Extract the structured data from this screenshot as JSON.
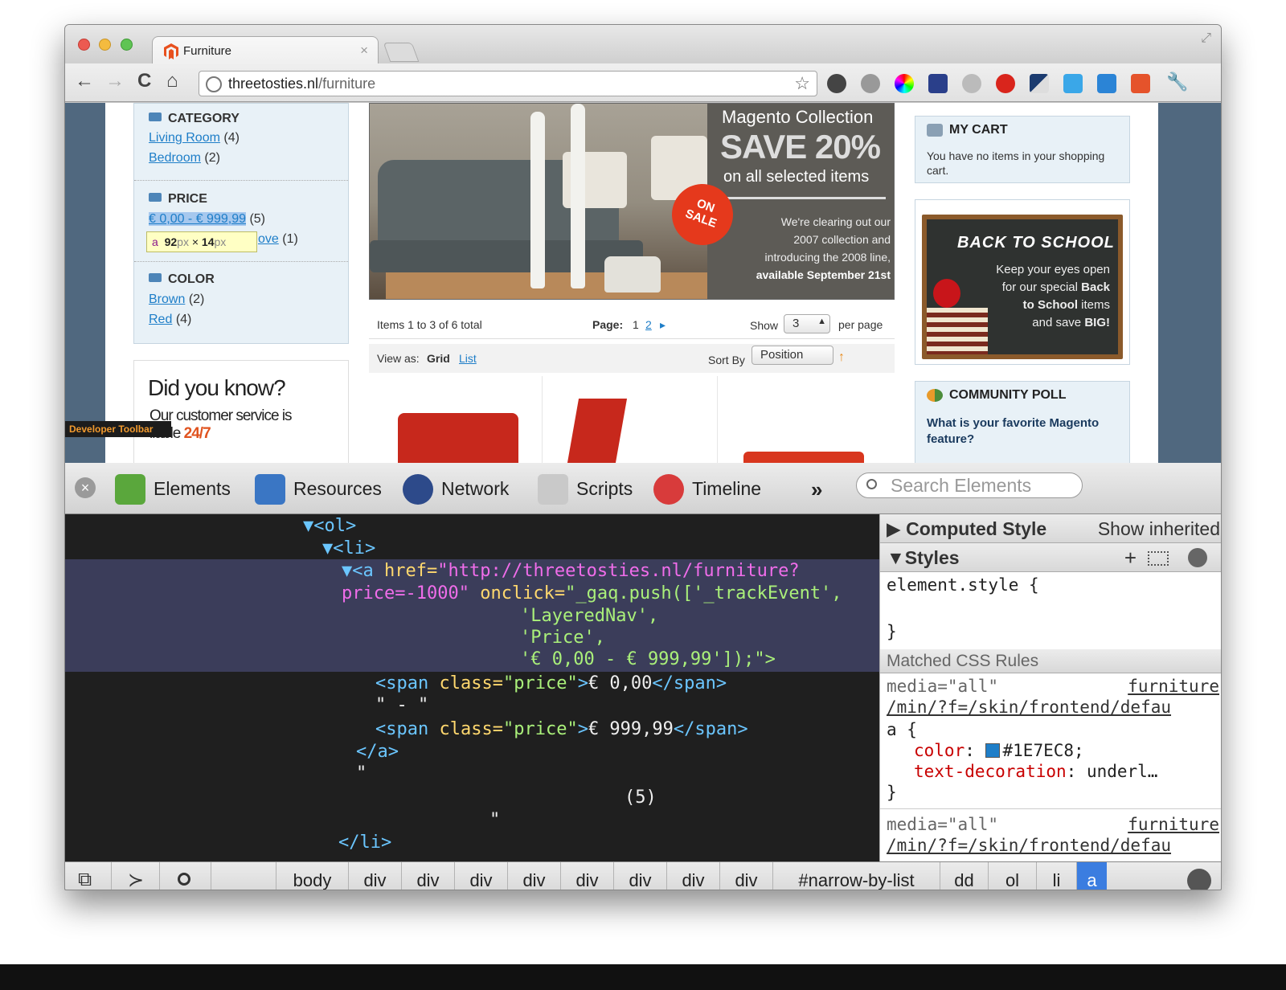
{
  "browser": {
    "tab_title": "Furniture",
    "tab_close": "×",
    "url_host": "threetosties.nl",
    "url_path": "/furniture",
    "resize_glyph": "⤢",
    "nav": {
      "back": "←",
      "forward": "→",
      "reload": "C",
      "home": "⌂",
      "star": "☆"
    }
  },
  "shop": {
    "category": {
      "title": "CATEGORY",
      "items": [
        {
          "label": "Living Room",
          "count": "(4)"
        },
        {
          "label": "Bedroom",
          "count": "(2)"
        }
      ]
    },
    "price": {
      "title": "PRICE",
      "items": [
        {
          "label": "€ 0,00 - € 999,99",
          "count": "(5)"
        },
        {
          "label": "ove",
          "count": "(1)"
        }
      ]
    },
    "color": {
      "title": "COLOR",
      "items": [
        {
          "label": "Brown",
          "count": "(2)"
        },
        {
          "label": "Red",
          "count": "(4)"
        }
      ]
    },
    "inspector_tooltip": {
      "tag": "a",
      "width": "92",
      "height": "14",
      "unit": "px",
      "times": "×"
    },
    "did_you_know": {
      "heading": "Did you know?",
      "line1": "Our customer service is",
      "line2_prefix": "ilable",
      "line2_hl": "24/7"
    },
    "developer_toolbar": "Developer Toolbar",
    "banner": {
      "collection": "Magento Collection",
      "save": "SAVE 20%",
      "selected": "on all selected items",
      "badge_line1": "ON",
      "badge_line2": "SALE",
      "desc1": "We're clearing out our",
      "desc2": "2007 collection and",
      "desc3": "introducing the 2008 line,",
      "desc4": "available September 21st"
    },
    "pager": {
      "items": "Items 1 to 3 of 6 total",
      "page_label": "Page:",
      "page_current": "1",
      "page_next": "2",
      "next_arrow": "▸",
      "show": "Show",
      "per_page_value": "3",
      "per_page": "per page"
    },
    "viewbar": {
      "view_as": "View as:",
      "grid": "Grid",
      "list": "List",
      "sort_by": "Sort By",
      "sort_value": "Position",
      "sort_dir": "↑"
    },
    "cart": {
      "title": "MY CART",
      "message": "You have no items in your shopping cart."
    },
    "promo": {
      "title": "BACK TO SCHOOL",
      "l1": "Keep your eyes open",
      "l2a": "for our special",
      "l2b": "Back",
      "l3a": "to School",
      "l3b": "items",
      "l4a": "and save",
      "l4b": "BIG!"
    },
    "poll": {
      "title": "COMMUNITY POLL",
      "question": "What is your favorite Magento feature?"
    }
  },
  "devtools": {
    "close": "×",
    "tabs": [
      {
        "label": "Elements",
        "color": "#5aa73c"
      },
      {
        "label": "Resources",
        "color": "#3a76c4"
      },
      {
        "label": "Network",
        "color": "#2d4a8a"
      },
      {
        "label": "Scripts",
        "color": "#c9c9c9"
      },
      {
        "label": "Timeline",
        "color": "#d83b3b"
      }
    ],
    "more": "»",
    "search_placeholder": "Search Elements",
    "code": {
      "ol": "▼<ol>",
      "li": "▼<li>",
      "a_open": "▼<a",
      "href_attr": "href=",
      "href_val": "\"http://threetosties.nl/furniture?",
      "href_val2": "price=-1000\"",
      "onclick_attr": "onclick=",
      "onclick_val": "\"_gaq.push(['_trackEvent',",
      "onclick_l2": "'LayeredNav',",
      "onclick_l3": "'Price',",
      "onclick_l4": "'€ 0,00 - € 999,99']);\">",
      "span1_open": "<span",
      "span_class": "class=",
      "span_class_val": "\"price\"",
      "span1_text": "€ 0,00",
      "span_close": "</span>",
      "dash": "\" - \"",
      "span2_text": "€ 999,99",
      "a_close": "</a>",
      "quote1": "\"",
      "count": "(5)",
      "quote2": "\"",
      "li_close": "</li>"
    },
    "styles": {
      "computed": "Computed Style",
      "show_inherited": "Show inherited",
      "styles_title": "Styles",
      "element_style": "element.style {",
      "close_brace": "}",
      "matched": "Matched CSS Rules",
      "media": "media=\"all\"",
      "source_file": "furniture",
      "source_path": "/min/?f=/skin/frontend/defau",
      "selector": "a {",
      "color_prop": "color",
      "color_val": "#1E7EC8",
      "td_prop": "text-decoration",
      "td_val": "underl…"
    },
    "breadcrumbs": [
      "body",
      "div",
      "div",
      "div",
      "div",
      "div",
      "div",
      "div",
      "div",
      "#narrow-by-list",
      "dd",
      "ol",
      "li",
      "a"
    ],
    "icons": {
      "dock": "⧉",
      "console": "≻",
      "search": "⌕"
    }
  }
}
